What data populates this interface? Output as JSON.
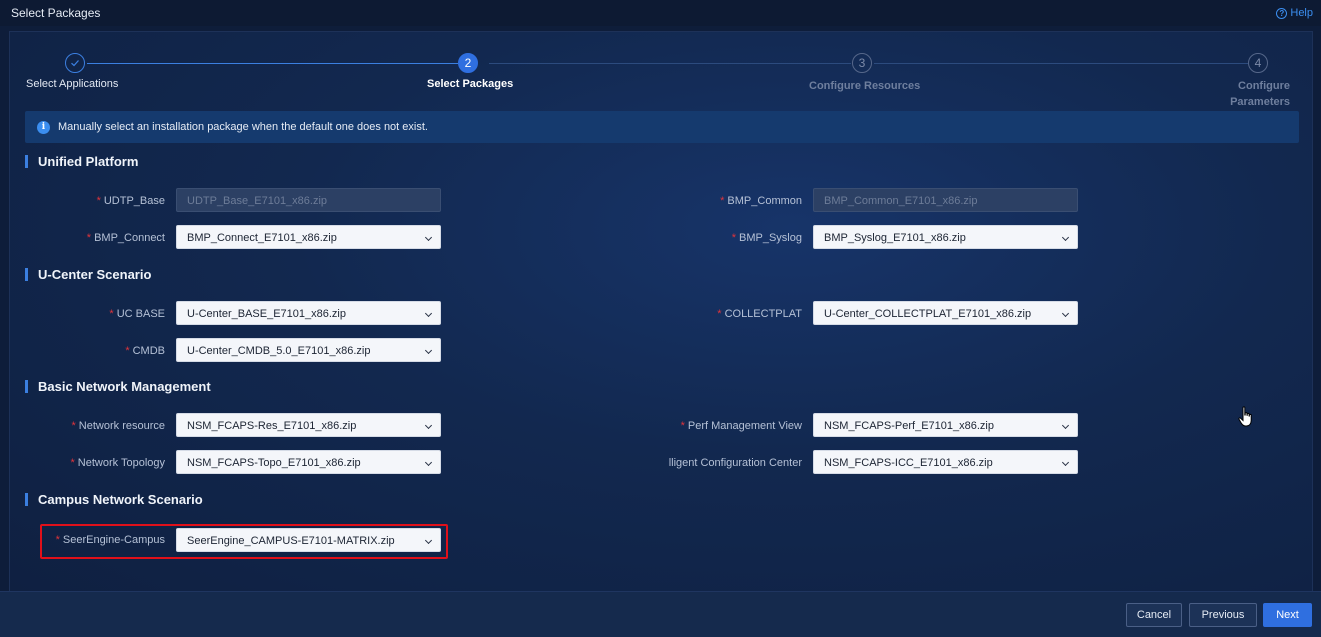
{
  "window": {
    "title": "Select Packages",
    "help_label": "Help"
  },
  "steps": [
    {
      "number": "1",
      "label": "Select Applications",
      "state": "done"
    },
    {
      "number": "2",
      "label": "Select Packages",
      "state": "active"
    },
    {
      "number": "3",
      "label": "Configure Resources",
      "state": "todo"
    },
    {
      "number": "4",
      "label_line1": "Configure",
      "label_line2": "Parameters",
      "state": "todo"
    }
  ],
  "info": {
    "message": "Manually select an installation package when the default one does not exist."
  },
  "sections": {
    "unified": {
      "title": "Unified Platform",
      "fields": {
        "udtp_base": {
          "label": "UDTP_Base",
          "value": "UDTP_Base_E7101_x86.zip"
        },
        "bmp_common": {
          "label": "BMP_Common",
          "value": "BMP_Common_E7101_x86.zip"
        },
        "bmp_connect": {
          "label": "BMP_Connect",
          "value": "BMP_Connect_E7101_x86.zip"
        },
        "bmp_syslog": {
          "label": "BMP_Syslog",
          "value": "BMP_Syslog_E7101_x86.zip"
        }
      }
    },
    "ucenter": {
      "title": "U-Center Scenario",
      "fields": {
        "uc_base": {
          "label": "UC BASE",
          "value": "U-Center_BASE_E7101_x86.zip"
        },
        "collectplat": {
          "label": "COLLECTPLAT",
          "value": "U-Center_COLLECTPLAT_E7101_x86.zip"
        },
        "cmdb": {
          "label": "CMDB",
          "value": "U-Center_CMDB_5.0_E7101_x86.zip"
        }
      }
    },
    "basic": {
      "title": "Basic Network Management",
      "fields": {
        "network_resource": {
          "label": "Network resource",
          "value": "NSM_FCAPS-Res_E7101_x86.zip"
        },
        "perf_view": {
          "label": "Perf Management View",
          "value": "NSM_FCAPS-Perf_E7101_x86.zip"
        },
        "network_topology": {
          "label": "Network Topology",
          "value": "NSM_FCAPS-Topo_E7101_x86.zip"
        },
        "icc": {
          "label": "lligent Configuration Center",
          "value": "NSM_FCAPS-ICC_E7101_x86.zip"
        }
      }
    },
    "campus": {
      "title": "Campus Network Scenario",
      "fields": {
        "seerengine": {
          "label": "SeerEngine-Campus",
          "value": "SeerEngine_CAMPUS-E7101-MATRIX.zip"
        }
      }
    }
  },
  "footer": {
    "cancel": "Cancel",
    "previous": "Previous",
    "next": "Next"
  },
  "colors": {
    "accent": "#2f6fe0",
    "required": "#e0343b",
    "highlight": "#e0101a"
  },
  "icons": {
    "step_done": "check-icon",
    "info": "info-icon",
    "help": "question-circle-icon",
    "select": "chevron-down-icon",
    "pointer": "hand-cursor-icon"
  }
}
